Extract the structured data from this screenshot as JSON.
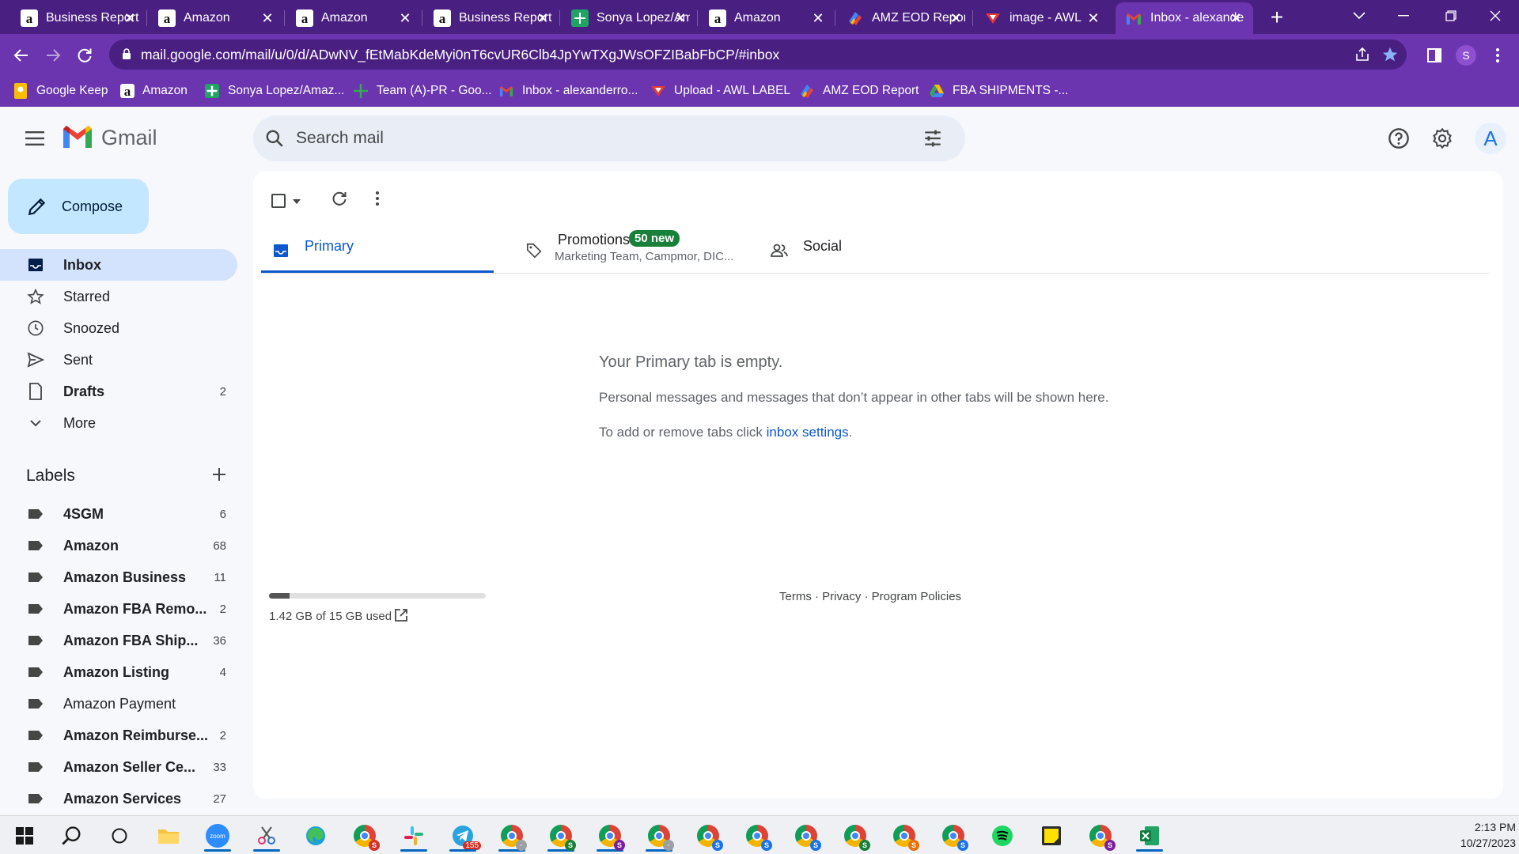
{
  "browser": {
    "tabs": [
      {
        "title": "Business Reports",
        "icon": "amazon-icon",
        "active": false
      },
      {
        "title": "Amazon",
        "icon": "amazon-icon",
        "active": false
      },
      {
        "title": "Amazon",
        "icon": "amazon-icon",
        "active": false
      },
      {
        "title": "Business Reports",
        "icon": "amazon-icon",
        "active": false
      },
      {
        "title": "Sonya Lopez/Amazon",
        "icon": "sheets-icon",
        "active": false
      },
      {
        "title": "Amazon",
        "icon": "amazon-icon",
        "active": false
      },
      {
        "title": "AMZ EOD Report",
        "icon": "appsheet-icon",
        "active": false
      },
      {
        "title": "image - AWL",
        "icon": "awl-icon",
        "active": false
      },
      {
        "title": "Inbox - alexanderro",
        "icon": "gmail-icon",
        "active": true
      }
    ],
    "new_tab_label": "+",
    "url": "mail.google.com/mail/u/0/d/ADwNV_fEtMabKdeMyi0nT6cvUR6Clb4JpYwTXgJWsOFZIBabFbCP/#inbox",
    "profile_initial": "S",
    "bookmarks": [
      {
        "label": "Google Keep",
        "icon": "keep-icon"
      },
      {
        "label": "Amazon",
        "icon": "amazon-icon"
      },
      {
        "label": "Sonya Lopez/Amaz...",
        "icon": "sheets-icon"
      },
      {
        "label": "Team (A)-PR - Goo...",
        "icon": "sheets-icon"
      },
      {
        "label": "Inbox - alexanderro...",
        "icon": "gmail-icon"
      },
      {
        "label": "Upload - AWL LABEL",
        "icon": "awl-icon"
      },
      {
        "label": "AMZ EOD Report",
        "icon": "appsheet-icon"
      },
      {
        "label": "FBA SHIPMENTS -...",
        "icon": "drive-icon"
      }
    ]
  },
  "gmail": {
    "logo_text": "Gmail",
    "search_placeholder": "Search mail",
    "avatar_initial": "A",
    "compose_label": "Compose",
    "nav": [
      {
        "label": "Inbox",
        "count": "",
        "icon": "inbox-icon",
        "active": true,
        "bold": true
      },
      {
        "label": "Starred",
        "count": "",
        "icon": "star-icon",
        "active": false,
        "bold": false
      },
      {
        "label": "Snoozed",
        "count": "",
        "icon": "clock-icon",
        "active": false,
        "bold": false
      },
      {
        "label": "Sent",
        "count": "",
        "icon": "send-icon",
        "active": false,
        "bold": false
      },
      {
        "label": "Drafts",
        "count": "2",
        "icon": "draft-icon",
        "active": false,
        "bold": true
      },
      {
        "label": "More",
        "count": "",
        "icon": "chevron-down-icon",
        "active": false,
        "bold": false
      }
    ],
    "labels_title": "Labels",
    "labels": [
      {
        "label": "4SGM",
        "count": "6",
        "bold": true
      },
      {
        "label": "Amazon",
        "count": "68",
        "bold": true
      },
      {
        "label": "Amazon Business",
        "count": "11",
        "bold": true
      },
      {
        "label": "Amazon FBA Remo...",
        "count": "2",
        "bold": true
      },
      {
        "label": "Amazon FBA Ship...",
        "count": "36",
        "bold": true
      },
      {
        "label": "Amazon Listing",
        "count": "4",
        "bold": true
      },
      {
        "label": "Amazon Payment",
        "count": "",
        "bold": false
      },
      {
        "label": "Amazon Reimburse...",
        "count": "2",
        "bold": true
      },
      {
        "label": "Amazon Seller Ce...",
        "count": "33",
        "bold": true
      },
      {
        "label": "Amazon Services",
        "count": "27",
        "bold": true
      }
    ],
    "tabs": {
      "primary": "Primary",
      "promotions": "Promotions",
      "promotions_badge": "50 new",
      "promotions_senders": "Marketing Team, Campmor, DIC...",
      "social": "Social"
    },
    "empty": {
      "title": "Your Primary tab is empty.",
      "description": "Personal messages and messages that don’t appear in other tabs will be shown here.",
      "settings_prefix": "To add or remove tabs click ",
      "settings_link": "inbox settings",
      "settings_suffix": "."
    },
    "storage": {
      "text": "1.42 GB of 15 GB used",
      "used_fraction": 0.095
    },
    "footer": "Terms · Privacy · Program Policies"
  },
  "taskbar": {
    "time": "2:13 PM",
    "date": "10/27/2023",
    "telegram_badge": "155"
  },
  "colors": {
    "browser_frame": "#4a1f82",
    "browser_toolbar": "#6a35ae",
    "gmail_accent": "#0b57d0",
    "compose_bg": "#c2e7ff",
    "nav_active_bg": "#d3e3fd",
    "promo_badge": "#188038"
  }
}
